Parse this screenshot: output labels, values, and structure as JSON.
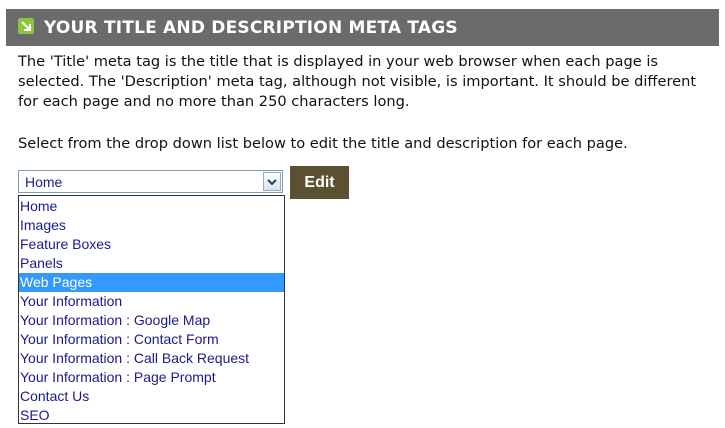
{
  "header": {
    "title": "YOUR TITLE AND DESCRIPTION META TAGS",
    "icon": "green-arrow-icon"
  },
  "intro_text": "The 'Title' meta tag is the title that is displayed in your web browser when each page is selected. The 'Description' meta tag, although not visible, is important. It should be different for each page and no more than 250 characters long.",
  "instructions": "Select from the drop down list below to edit the title and description for each page.",
  "page_select": {
    "selected_value": "Home",
    "arrow_icon": "chevron-down-icon",
    "options": [
      "Home",
      "Images",
      "Feature Boxes",
      "Panels",
      "Web Pages",
      "Your Information",
      "Your Information : Google Map",
      "Your Information : Contact Form",
      "Your Information : Call Back Request",
      "Your Information : Page Prompt",
      "Contact Us",
      "SEO"
    ],
    "highlighted_option": "Web Pages"
  },
  "edit_button": {
    "label": "Edit"
  },
  "colors": {
    "header_bg": "#6b6b6b",
    "header_icon": "#8cc63f",
    "button_bg": "#5c5032",
    "option_text": "#1a1a8c",
    "highlight": "#3399ff"
  }
}
